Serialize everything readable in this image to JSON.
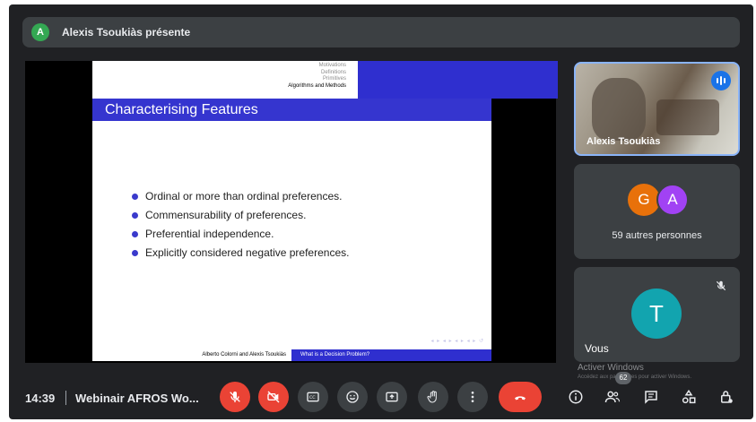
{
  "presenter": {
    "avatar_letter": "A",
    "text": "Alexis Tsoukiàs présente"
  },
  "slide": {
    "nav_items": [
      "Motivations",
      "Definitions",
      "Primitives",
      "Algorithms and Methods"
    ],
    "active_nav": "Algorithms and Methods",
    "title": "Characterising Features",
    "bullets": [
      "Ordinal or more than ordinal preferences.",
      "Commensurability of preferences.",
      "Preferential independence.",
      "Explicitly considered negative preferences."
    ],
    "footer_left": "Alberto Colorni and Alexis Tsoukiàs",
    "footer_right": "What is a Decision Problem?",
    "colors": {
      "blue": "#2f2fcf"
    }
  },
  "tiles": {
    "speaker_name": "Alexis Tsoukiàs",
    "group": {
      "avatar1": "G",
      "avatar2": "A",
      "label": "59 autres personnes"
    },
    "self": {
      "avatar": "T",
      "label": "Vous"
    }
  },
  "watermark": {
    "title": "Activer Windows",
    "subtitle": "Accédez aux paramètres pour activer Windows."
  },
  "bottom_bar": {
    "time": "14:39",
    "separator": "|",
    "meeting_name": "Webinair AFROS Wo...",
    "participant_count": "62",
    "icons": [
      "mic-off-icon",
      "camera-off-icon",
      "captions-icon",
      "emoji-icon",
      "present-icon",
      "raise-hand-icon",
      "more-options-icon",
      "end-call-icon",
      "info-icon",
      "people-icon",
      "chat-icon",
      "activities-icon",
      "host-controls-icon"
    ]
  }
}
